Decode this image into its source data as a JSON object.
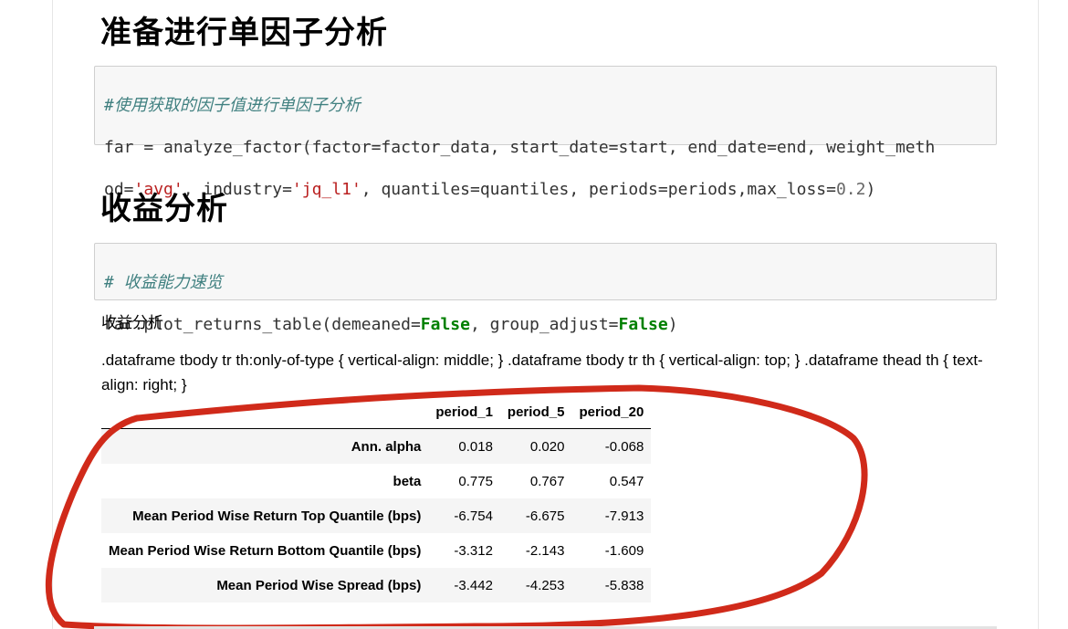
{
  "headings": {
    "prepare": "准备进行单因子分析",
    "returns": "收益分析"
  },
  "cell1": {
    "comment": "#使用获取的因子值进行单因子分析",
    "line1": "far = analyze_factor(factor=factor_data, start_date=start, end_date=end, weight_meth",
    "line2_a": "od=",
    "line2_str1": "'avg'",
    "line2_b": ", industry=",
    "line2_str2": "'jq_l1'",
    "line2_c": ", quantiles=quantiles, periods=periods,max_loss=",
    "line2_num": "0.2",
    "line2_d": ")"
  },
  "cell2": {
    "comment": "# 收益能力速览",
    "line1_a": "far.plot_returns_table(demeaned=",
    "line1_kw1": "False",
    "line1_b": ", group_adjust=",
    "line1_kw2": "False",
    "line1_c": ")"
  },
  "output": {
    "title": "收益分析",
    "css_leak": ".dataframe tbody tr th:only-of-type { vertical-align: middle; } .dataframe tbody tr th { vertical-align: top; } .dataframe thead th { text-align: right; }"
  },
  "table": {
    "columns": [
      "",
      "period_1",
      "period_5",
      "period_20"
    ],
    "rows": [
      {
        "label": "Ann. alpha",
        "values": [
          "0.018",
          "0.020",
          "-0.068"
        ]
      },
      {
        "label": "beta",
        "values": [
          "0.775",
          "0.767",
          "0.547"
        ]
      },
      {
        "label": "Mean Period Wise Return Top Quantile (bps)",
        "values": [
          "-6.754",
          "-6.675",
          "-7.913"
        ]
      },
      {
        "label": "Mean Period Wise Return Bottom Quantile (bps)",
        "values": [
          "-3.312",
          "-2.143",
          "-1.609"
        ]
      },
      {
        "label": "Mean Period Wise Spread (bps)",
        "values": [
          "-3.442",
          "-4.253",
          "-5.838"
        ]
      }
    ]
  },
  "colors": {
    "annotation": "#d02a1a",
    "comment": "#408080",
    "string": "#ba2121",
    "keyword": "#008000"
  }
}
